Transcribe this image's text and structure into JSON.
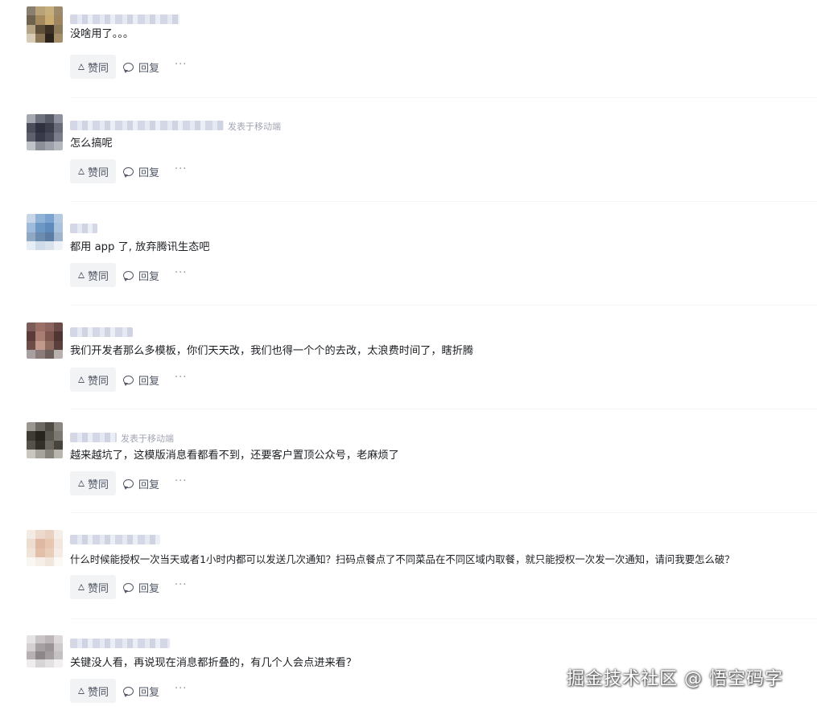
{
  "actions": {
    "like_label": "赞同",
    "reply_label": "回复",
    "more_label": "···"
  },
  "comments": [
    {
      "text": "没啥用了。。。",
      "from": ""
    },
    {
      "text": "怎么搞呢",
      "from": "发表于移动端"
    },
    {
      "text": "都用 app 了, 放弃腾讯生态吧",
      "from": ""
    },
    {
      "text": "我们开发者那么多模板，你们天天改，我们也得一个个的去改，太浪费时间了，瞎折腾",
      "from": ""
    },
    {
      "text": "越来越坑了，这模版消息看都看不到，还要客户置顶公众号，老麻烦了",
      "from": "发表于移动端"
    },
    {
      "text": "什么时候能授权一次当天或者1小时内都可以发送几次通知？扫码点餐点了不同菜品在不同区域内取餐，就只能授权一次发一次通知，请问我要怎么破？",
      "from": ""
    },
    {
      "text": "关键没人看，再说现在消息都折叠的，有几个人会点进来看？",
      "from": ""
    }
  ],
  "watermark": "掘金技术社区 @ 悟空码字",
  "avatar_colors": [
    [
      "#8a7f6e",
      "#b8a27a",
      "#c6ae7d",
      "#9b8a6c",
      "#6e634f",
      "#a3895d",
      "#c9aa70",
      "#9d8660",
      "#b6a487",
      "#5e4f38",
      "#3b3125",
      "#8e7b5c",
      "#d7cbb6",
      "#8b7758",
      "#2c241b",
      "#a58e6a"
    ],
    [
      "#a6a8b1",
      "#6f727d",
      "#575b68",
      "#8f929c",
      "#4c4f5b",
      "#2f3140",
      "#3d3f4d",
      "#6a6d78",
      "#5e616d",
      "#383a49",
      "#494b58",
      "#7b7e89",
      "#c0c2c9",
      "#8c8e98",
      "#9fa1aa",
      "#b5b7bf"
    ],
    [
      "#c7d6e7",
      "#8fb2d6",
      "#7aa3cf",
      "#b4c9e0",
      "#9fbbdb",
      "#6d97c5",
      "#5f8bbc",
      "#a9c3df",
      "#8fa9c4",
      "#6c8caf",
      "#5b7da3",
      "#9fb5cd",
      "#e6edf4",
      "#cfdbe8",
      "#d9e2ec",
      "#eef2f7"
    ],
    [
      "#7a5c58",
      "#9c6f66",
      "#8d6460",
      "#6b4c49",
      "#5c3b38",
      "#a87d72",
      "#7d5650",
      "#4f3633",
      "#6e4c47",
      "#c29a8c",
      "#8e6a61",
      "#5a403c",
      "#a8a0a0",
      "#8b7c79",
      "#6d5f5c",
      "#b9b1b0"
    ],
    [
      "#9a9690",
      "#6d6a63",
      "#4e4b45",
      "#8a8780",
      "#3f3c36",
      "#26241f",
      "#5a5750",
      "#7c7972",
      "#55524b",
      "#33302a",
      "#6b675f",
      "#47443d",
      "#c9c6c0",
      "#a7a49d",
      "#85827b",
      "#b8b5ae"
    ],
    [
      "#f3ebe4",
      "#ecd9cc",
      "#e8d1c0",
      "#f5eee8",
      "#eddcd0",
      "#dfb8a3",
      "#e6c5b1",
      "#f2e7de",
      "#f0e3d8",
      "#e2bfa9",
      "#e9cdbb",
      "#f4ece5",
      "#faf6f2",
      "#f6efe9",
      "#f1e6dc",
      "#fbf8f5"
    ],
    [
      "#e5e3e3",
      "#c9c4c5",
      "#bdb6b8",
      "#dcd8d9",
      "#d4cfd0",
      "#a7a0a2",
      "#9b9496",
      "#cfcacb",
      "#b7b1b3",
      "#8d8789",
      "#a39d9f",
      "#c5c0c1",
      "#efeded",
      "#d9d5d6",
      "#e4e1e1",
      "#f2f0f0"
    ]
  ]
}
